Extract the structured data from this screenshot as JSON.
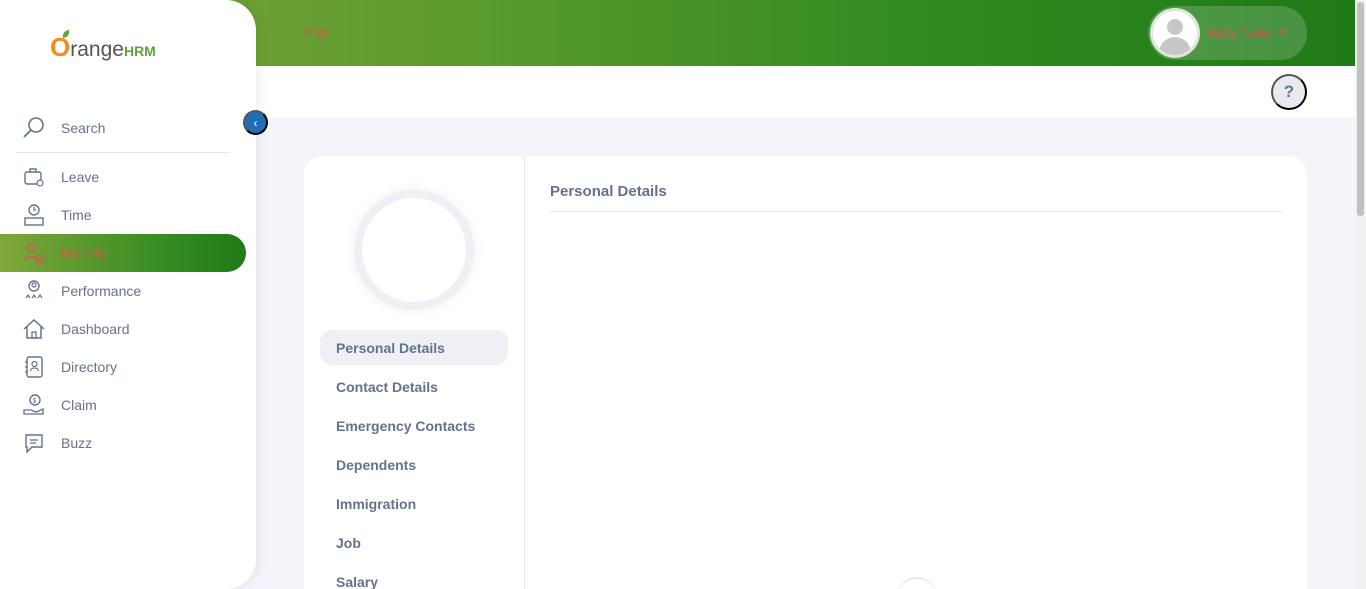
{
  "header": {
    "module_title": "PIM",
    "user_name": "Kirby Turner",
    "help_label": "?"
  },
  "sidebar": {
    "brand": {
      "o": "O",
      "range": "range",
      "hrm": "HRM"
    },
    "search_label": "Search",
    "items": [
      {
        "label": "Leave",
        "icon": "leave-icon"
      },
      {
        "label": "Time",
        "icon": "time-icon"
      },
      {
        "label": "My Info",
        "icon": "my-info-icon",
        "active": true
      },
      {
        "label": "Performance",
        "icon": "performance-icon"
      },
      {
        "label": "Dashboard",
        "icon": "dashboard-icon"
      },
      {
        "label": "Directory",
        "icon": "directory-icon"
      },
      {
        "label": "Claim",
        "icon": "claim-icon"
      },
      {
        "label": "Buzz",
        "icon": "buzz-icon"
      }
    ]
  },
  "profile": {
    "tabs": [
      {
        "label": "Personal Details",
        "active": true
      },
      {
        "label": "Contact Details"
      },
      {
        "label": "Emergency Contacts"
      },
      {
        "label": "Dependents"
      },
      {
        "label": "Immigration"
      },
      {
        "label": "Job"
      },
      {
        "label": "Salary"
      }
    ],
    "section_title": "Personal Details"
  },
  "colors": {
    "accent_green": "#5fa33b",
    "accent_orange": "#f28c1a",
    "active_text": "#d9534f",
    "collapse_blue": "#1e6fb8"
  }
}
